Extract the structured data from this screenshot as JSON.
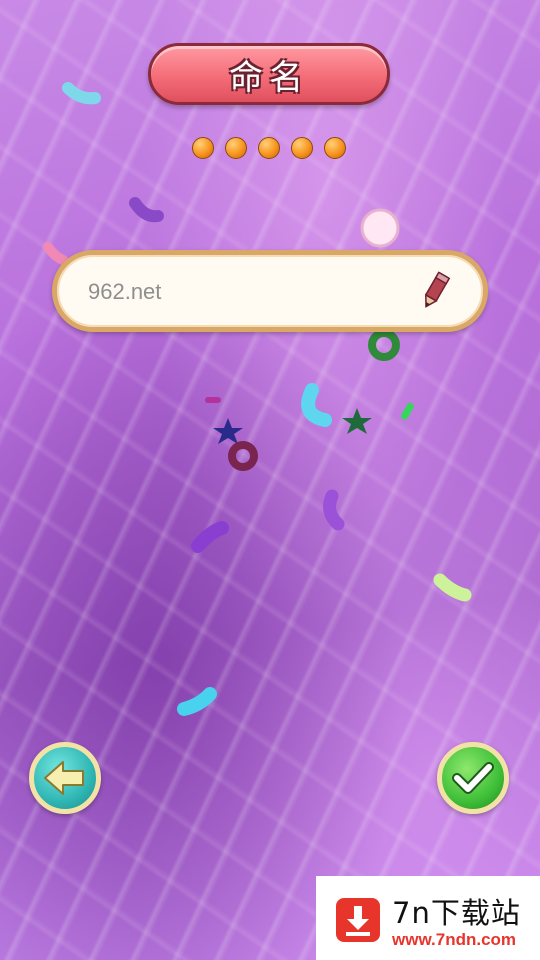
{
  "header": {
    "title": "命名"
  },
  "progress": {
    "total_dots": 5
  },
  "name_input": {
    "value": "962.net",
    "icon": "pencil-icon"
  },
  "nav": {
    "back_icon": "arrow-left-icon",
    "confirm_icon": "checkmark-icon"
  },
  "watermark": {
    "title": "7n下载站",
    "url": "www.7ndn.com"
  },
  "colors": {
    "title_banner": "#f46d78",
    "dot": "#f7941d",
    "field_border": "#d9a766",
    "back_button": "#2fb6b4",
    "confirm_button": "#3fbf38",
    "watermark_accent": "#e8352c"
  }
}
